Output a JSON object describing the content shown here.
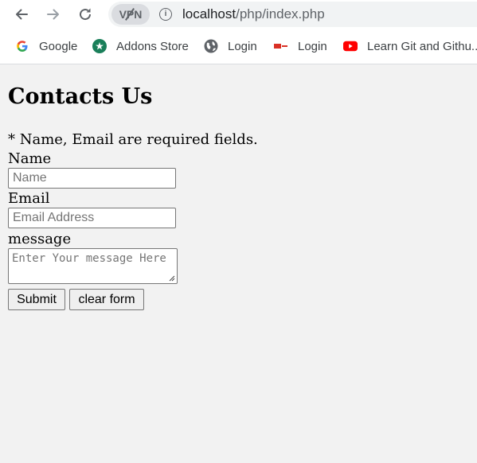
{
  "browser": {
    "vpn_label": "VPN",
    "url_host": "localhost",
    "url_path": "/php/index.php",
    "bookmarks": [
      {
        "label": "Google",
        "icon": "google-icon"
      },
      {
        "label": "Addons Store",
        "icon": "addons-store-icon"
      },
      {
        "label": "Login",
        "icon": "globe-icon"
      },
      {
        "label": "Login",
        "icon": "login-site-icon"
      },
      {
        "label": "Learn Git and Githu...",
        "icon": "youtube-icon"
      }
    ]
  },
  "page": {
    "heading": "Contacts Us",
    "required_note": "* Name, Email are required fields.",
    "name_label": "Name",
    "name_placeholder": "Name",
    "email_label": "Email",
    "email_placeholder": "Email Address",
    "message_label": "message",
    "message_placeholder": "Enter Your message Here",
    "submit_label": "Submit",
    "clear_label": "clear form"
  },
  "colors": {
    "page_bg": "#f2f2f2",
    "chrome_bg": "#ffffff",
    "omnibox_bg": "#f1f3f4"
  }
}
